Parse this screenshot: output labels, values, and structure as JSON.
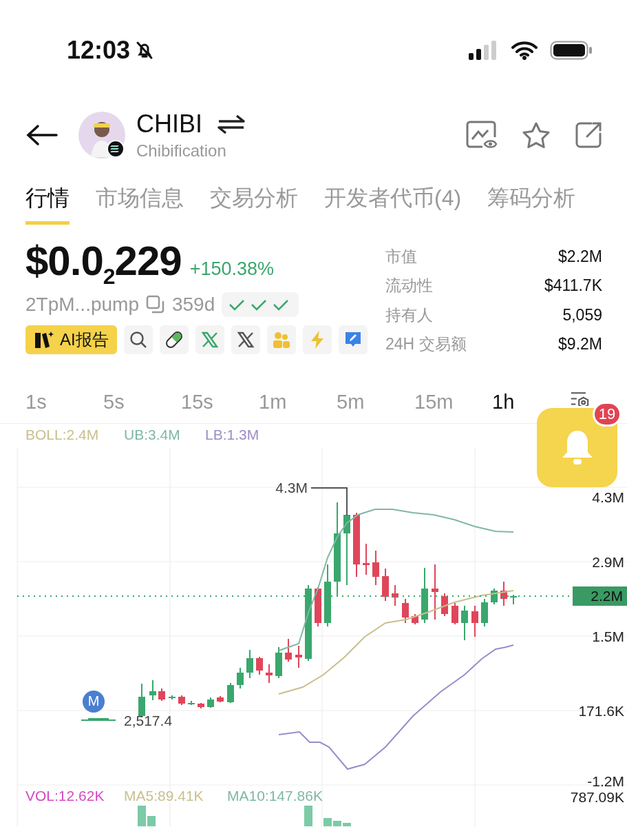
{
  "status_bar": {
    "time": "12:03"
  },
  "header": {
    "symbol": "CHIBI",
    "name": "Chibification"
  },
  "tabs": [
    {
      "label": "行情",
      "selected": true
    },
    {
      "label": "市场信息",
      "selected": false
    },
    {
      "label": "交易分析",
      "selected": false
    },
    {
      "label": "开发者代币(4)",
      "selected": false
    },
    {
      "label": "筹码分析",
      "selected": false
    }
  ],
  "price": {
    "value": "$0.0$_{2}$229",
    "change": "+150.38%",
    "address": "2TpM...pump",
    "age": "359d",
    "ai_button": "AI报告"
  },
  "stats": [
    {
      "label": "市值",
      "value": "$2.2M"
    },
    {
      "label": "流动性",
      "value": "$411.7K"
    },
    {
      "label": "持有人",
      "value": "5,059"
    },
    {
      "label": "24H 交易额",
      "value": "$9.2M"
    }
  ],
  "intervals": [
    {
      "label": "1s",
      "selected": false
    },
    {
      "label": "5s",
      "selected": false
    },
    {
      "label": "15s",
      "selected": false
    },
    {
      "label": "1m",
      "selected": false
    },
    {
      "label": "5m",
      "selected": false
    },
    {
      "label": "15m",
      "selected": false
    },
    {
      "label": "1h",
      "selected": true
    }
  ],
  "alert_button": {
    "badge": "19"
  },
  "chart": {
    "legend": [
      {
        "text": "BOLL:2.4M",
        "color": "#c9bf8c"
      },
      {
        "text": "UB:3.4M",
        "color": "#7fb8a4"
      },
      {
        "text": "LB:1.3M",
        "color": "#9b8bcb"
      }
    ],
    "axis_labels": [
      "4.3M",
      "2.9M",
      "1.5M",
      "171.6K",
      "-1.2M"
    ],
    "high_label": "4.3M",
    "low_label": "2,517.4",
    "current_price": "2.2M",
    "marker": "M",
    "volume_legend": [
      {
        "text": "VOL:12.62K",
        "color": "#d548c4"
      },
      {
        "text": "MA5:89.41K",
        "color": "#c9bf8c"
      },
      {
        "text": "MA10:147.86K",
        "color": "#7fb8a4"
      }
    ],
    "volume_axis_label": "787.09K"
  }
}
